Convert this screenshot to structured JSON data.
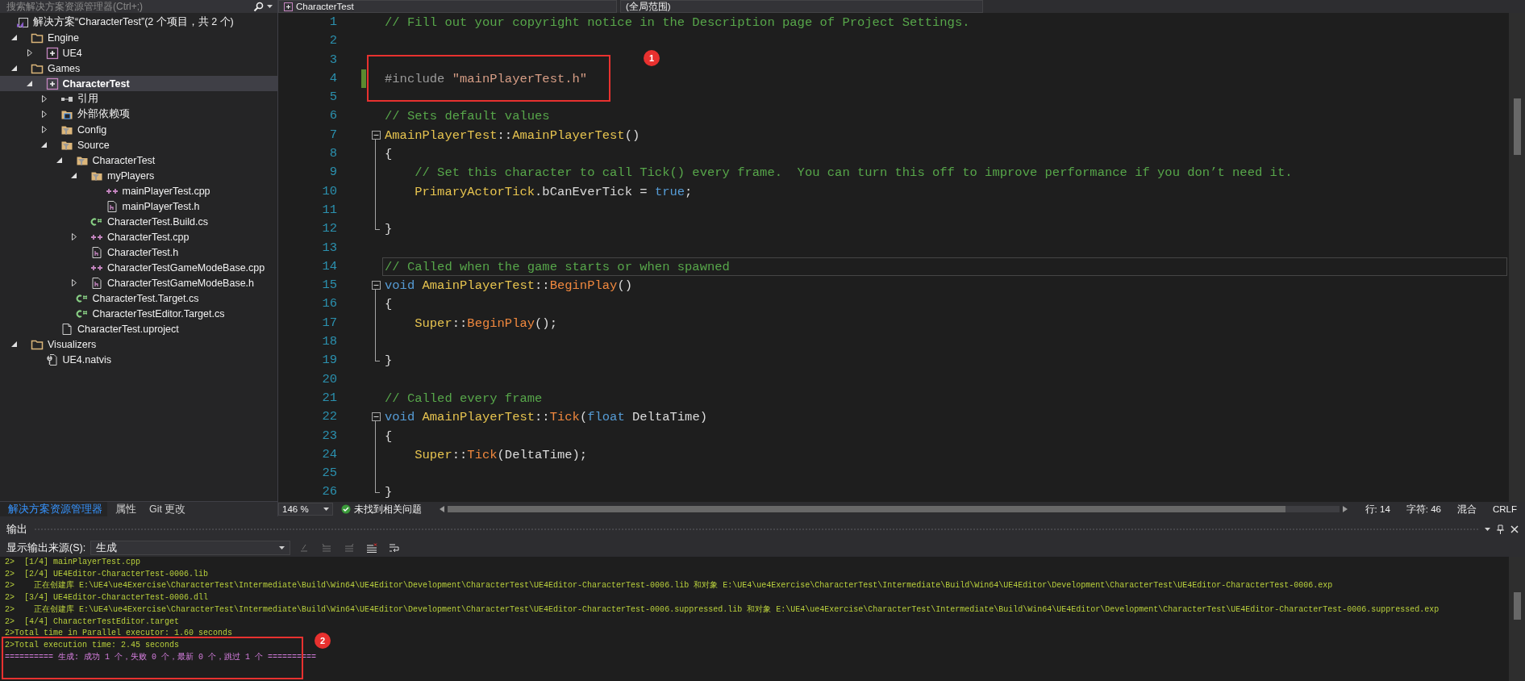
{
  "solution_explorer": {
    "placeholder": "搜索解决方案资源管理器(Ctrl+;)",
    "solution": "解决方案“CharacterTest”(2 个项目，共 2 个)",
    "tree": [
      {
        "label": "Engine",
        "kind": "folder",
        "expanded": true,
        "selected": false,
        "children": [
          {
            "label": "UE4",
            "kind": "project",
            "expanded": false,
            "selected": false
          }
        ]
      },
      {
        "label": "Games",
        "kind": "folder",
        "expanded": true,
        "selected": false,
        "children": [
          {
            "label": "CharacterTest",
            "kind": "project",
            "expanded": true,
            "selected": true,
            "children": [
              {
                "label": "引用",
                "kind": "references",
                "expanded": false,
                "selected": false
              },
              {
                "label": "外部依赖项",
                "kind": "dependencies",
                "expanded": false,
                "selected": false
              },
              {
                "label": "Config",
                "kind": "filter",
                "expanded": false,
                "selected": false
              },
              {
                "label": "Source",
                "kind": "filter",
                "expanded": true,
                "selected": false,
                "children": [
                  {
                    "label": "CharacterTest",
                    "kind": "filter",
                    "expanded": true,
                    "selected": false,
                    "children": [
                      {
                        "label": "myPlayers",
                        "kind": "filter",
                        "expanded": true,
                        "selected": false,
                        "children": [
                          {
                            "label": "mainPlayerTest.cpp",
                            "kind": "cpp",
                            "selected": false
                          },
                          {
                            "label": "mainPlayerTest.h",
                            "kind": "header",
                            "selected": false
                          }
                        ]
                      },
                      {
                        "label": "CharacterTest.Build.cs",
                        "kind": "csharp",
                        "selected": false
                      },
                      {
                        "label": "CharacterTest.cpp",
                        "kind": "cpp",
                        "expanded": false,
                        "selected": false
                      },
                      {
                        "label": "CharacterTest.h",
                        "kind": "header",
                        "selected": false
                      },
                      {
                        "label": "CharacterTestGameModeBase.cpp",
                        "kind": "cpp",
                        "selected": false
                      },
                      {
                        "label": "CharacterTestGameModeBase.h",
                        "kind": "header",
                        "expanded": false,
                        "selected": false
                      }
                    ]
                  },
                  {
                    "label": "CharacterTest.Target.cs",
                    "kind": "csharp",
                    "selected": false
                  },
                  {
                    "label": "CharacterTestEditor.Target.cs",
                    "kind": "csharp",
                    "selected": false
                  }
                ]
              },
              {
                "label": "CharacterTest.uproject",
                "kind": "file",
                "selected": false
              }
            ]
          }
        ]
      },
      {
        "label": "Visualizers",
        "kind": "folder",
        "expanded": true,
        "selected": false,
        "children": [
          {
            "label": "UE4.natvis",
            "kind": "natvis",
            "selected": false
          }
        ]
      }
    ],
    "tabs": [
      {
        "label": "解决方案资源管理器",
        "selected": true
      },
      {
        "label": "属性",
        "selected": false
      },
      {
        "label": "Git 更改",
        "selected": false
      }
    ]
  },
  "editor": {
    "navigation": [
      {
        "label": "CharacterTest"
      },
      {
        "label": "(全局范围)"
      }
    ],
    "lines": [
      {
        "number": "1",
        "kind": "plain",
        "changed": false,
        "current": false,
        "tokens": [
          {
            "kind": "comment",
            "text": "// Fill out your copyright notice in the Description page of Project Settings."
          }
        ]
      },
      {
        "number": "2",
        "kind": "plain",
        "changed": false,
        "current": false
      },
      {
        "number": "3",
        "kind": "plain",
        "changed": false,
        "current": false
      },
      {
        "number": "4",
        "kind": "plain",
        "changed": true,
        "current": false,
        "tokens": [
          {
            "kind": "preprocessor",
            "text": "#include "
          },
          {
            "kind": "string",
            "text": "\"mainPlayerTest.h\""
          }
        ]
      },
      {
        "number": "5",
        "kind": "plain",
        "changed": false,
        "current": false
      },
      {
        "number": "6",
        "kind": "plain",
        "changed": false,
        "current": false,
        "tokens": [
          {
            "kind": "comment",
            "text": "// Sets default values"
          }
        ]
      },
      {
        "number": "7",
        "kind": "block_start",
        "changed": false,
        "current": false,
        "tokens": [
          {
            "kind": "type",
            "text": "AmainPlayerTest"
          },
          {
            "kind": "plain",
            "text": "::"
          },
          {
            "kind": "type",
            "text": "AmainPlayerTest"
          },
          {
            "kind": "plain",
            "text": "()"
          }
        ]
      },
      {
        "number": "8",
        "kind": "block_body",
        "changed": false,
        "current": false,
        "tokens": [
          {
            "kind": "plain",
            "text": "{"
          }
        ]
      },
      {
        "number": "9",
        "kind": "block_body",
        "changed": false,
        "current": false,
        "tokens": [
          {
            "kind": "comment",
            "text": "    // Set this character to call Tick() every frame.  You can turn this off to improve performance if you don’t need it."
          }
        ]
      },
      {
        "number": "10",
        "kind": "block_body",
        "changed": false,
        "current": false,
        "tokens": [
          {
            "kind": "type",
            "text": "    PrimaryActorTick"
          },
          {
            "kind": "plain",
            "text": "."
          },
          {
            "kind": "member",
            "text": "bCanEverTick"
          },
          {
            "kind": "plain",
            "text": " = "
          },
          {
            "kind": "keyword",
            "text": "true"
          },
          {
            "kind": "plain",
            "text": ";"
          }
        ]
      },
      {
        "number": "11",
        "kind": "block_body",
        "changed": false,
        "current": false
      },
      {
        "number": "12",
        "kind": "block_end",
        "changed": false,
        "current": false,
        "tokens": [
          {
            "kind": "plain",
            "text": "}"
          }
        ]
      },
      {
        "number": "13",
        "kind": "plain",
        "changed": false,
        "current": false
      },
      {
        "number": "14",
        "kind": "plain",
        "changed": false,
        "current": true,
        "tokens": [
          {
            "kind": "comment",
            "text": "// Called when the game starts or when spawned"
          }
        ]
      },
      {
        "number": "15",
        "kind": "block_start",
        "changed": false,
        "current": false,
        "tokens": [
          {
            "kind": "keyword",
            "text": "void "
          },
          {
            "kind": "type",
            "text": "AmainPlayerTest"
          },
          {
            "kind": "plain",
            "text": "::"
          },
          {
            "kind": "function",
            "text": "BeginPlay"
          },
          {
            "kind": "plain",
            "text": "()"
          }
        ]
      },
      {
        "number": "16",
        "kind": "block_body",
        "changed": false,
        "current": false,
        "tokens": [
          {
            "kind": "plain",
            "text": "{"
          }
        ]
      },
      {
        "number": "17",
        "kind": "block_body",
        "changed": false,
        "current": false,
        "tokens": [
          {
            "kind": "type",
            "text": "    Super"
          },
          {
            "kind": "plain",
            "text": "::"
          },
          {
            "kind": "function",
            "text": "BeginPlay"
          },
          {
            "kind": "plain",
            "text": "();"
          }
        ]
      },
      {
        "number": "18",
        "kind": "block_body",
        "changed": false,
        "current": false
      },
      {
        "number": "19",
        "kind": "block_end",
        "changed": false,
        "current": false,
        "tokens": [
          {
            "kind": "plain",
            "text": "}"
          }
        ]
      },
      {
        "number": "20",
        "kind": "plain",
        "changed": false,
        "current": false
      },
      {
        "number": "21",
        "kind": "plain",
        "changed": false,
        "current": false,
        "tokens": [
          {
            "kind": "comment",
            "text": "// Called every frame"
          }
        ]
      },
      {
        "number": "22",
        "kind": "block_start",
        "changed": false,
        "current": false,
        "tokens": [
          {
            "kind": "keyword",
            "text": "void "
          },
          {
            "kind": "type",
            "text": "AmainPlayerTest"
          },
          {
            "kind": "plain",
            "text": "::"
          },
          {
            "kind": "function",
            "text": "Tick"
          },
          {
            "kind": "plain",
            "text": "("
          },
          {
            "kind": "keyword",
            "text": "float"
          },
          {
            "kind": "plain",
            "text": " DeltaTime)"
          }
        ]
      },
      {
        "number": "23",
        "kind": "block_body",
        "changed": false,
        "current": false,
        "tokens": [
          {
            "kind": "plain",
            "text": "{"
          }
        ]
      },
      {
        "number": "24",
        "kind": "block_body",
        "changed": false,
        "current": false,
        "tokens": [
          {
            "kind": "type",
            "text": "    Super"
          },
          {
            "kind": "plain",
            "text": "::"
          },
          {
            "kind": "function",
            "text": "Tick"
          },
          {
            "kind": "plain",
            "text": "(DeltaTime);"
          }
        ]
      },
      {
        "number": "25",
        "kind": "block_body",
        "changed": false,
        "current": false
      },
      {
        "number": "26",
        "kind": "block_end",
        "changed": false,
        "current": false,
        "tokens": [
          {
            "kind": "plain",
            "text": "}"
          }
        ]
      }
    ],
    "annotation": {
      "label": "1"
    },
    "status": {
      "zoom": "146 %",
      "issues": "未找到相关问题",
      "line": "行: 14",
      "column": "字符: 46",
      "mode": "混合",
      "line_ending": "CRLF"
    }
  },
  "output": {
    "title": "输出",
    "source_label": "显示输出来源(S):",
    "source": "生成",
    "lines": [
      {
        "kind": "log",
        "text": "2>  [1/4] mainPlayerTest.cpp"
      },
      {
        "kind": "log",
        "text": "2>  [2/4] UE4Editor-CharacterTest-0006.lib"
      },
      {
        "kind": "log",
        "text": "2>    正在创建库 E:\\UE4\\ue4Exercise\\CharacterTest\\Intermediate\\Build\\Win64\\UE4Editor\\Development\\CharacterTest\\UE4Editor-CharacterTest-0006.lib 和对象 E:\\UE4\\ue4Exercise\\CharacterTest\\Intermediate\\Build\\Win64\\UE4Editor\\Development\\CharacterTest\\UE4Editor-CharacterTest-0006.exp"
      },
      {
        "kind": "log",
        "text": "2>  [3/4] UE4Editor-CharacterTest-0006.dll"
      },
      {
        "kind": "log",
        "text": "2>    正在创建库 E:\\UE4\\ue4Exercise\\CharacterTest\\Intermediate\\Build\\Win64\\UE4Editor\\Development\\CharacterTest\\UE4Editor-CharacterTest-0006.suppressed.lib 和对象 E:\\UE4\\ue4Exercise\\CharacterTest\\Intermediate\\Build\\Win64\\UE4Editor\\Development\\CharacterTest\\UE4Editor-CharacterTest-0006.suppressed.exp"
      },
      {
        "kind": "log",
        "text": "2>  [4/4] CharacterTestEditor.target"
      },
      {
        "kind": "log",
        "text": "2>Total time in Parallel executor: 1.60 seconds"
      },
      {
        "kind": "log",
        "text": "2>Total execution time: 2.45 seconds"
      },
      {
        "kind": "summary",
        "text": "========== 生成: 成功 1 个，失败 0 个，最新 0 个，跳过 1 个 =========="
      }
    ],
    "annotation": {
      "label": "2"
    }
  }
}
